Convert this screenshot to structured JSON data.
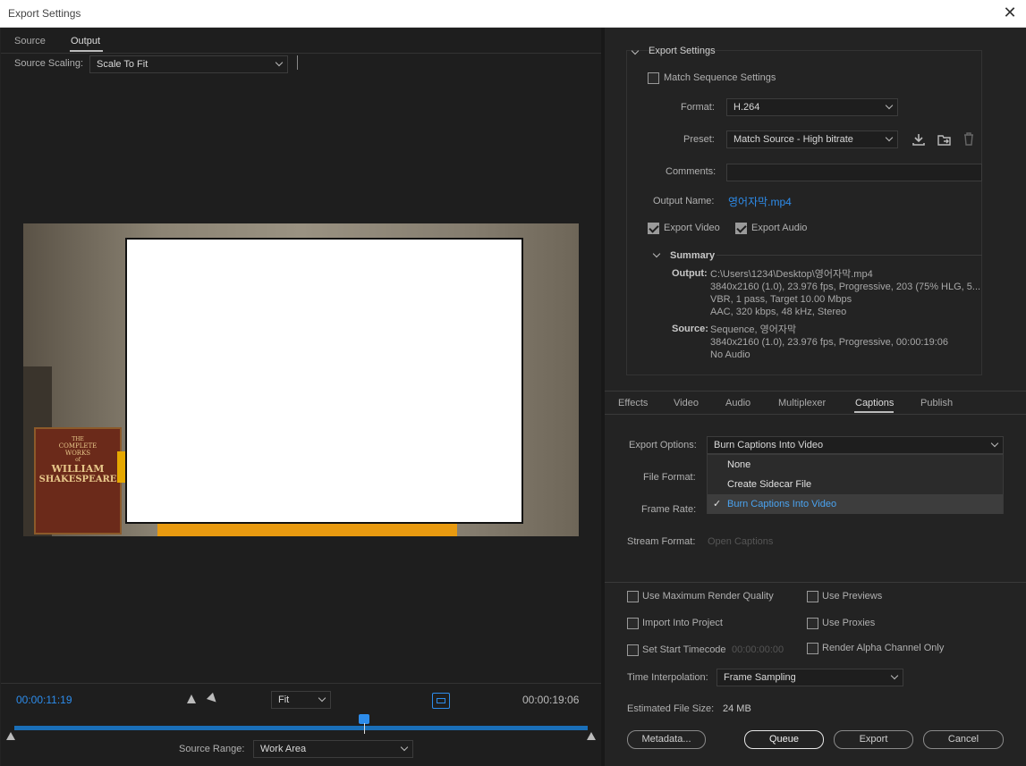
{
  "window": {
    "title": "Export Settings",
    "close_glyph": "✕"
  },
  "left": {
    "tabs": [
      {
        "label": "Source"
      },
      {
        "label": "Output"
      }
    ],
    "source_scaling_label": "Source Scaling:",
    "source_scaling_value": "Scale To Fit",
    "preview_book": {
      "line1": "THE",
      "line2": "COMPLETE",
      "line3": "WORKS",
      "line4": "of",
      "line5": "WILLIAM",
      "line6": "SHAKESPEARE"
    },
    "timecode_current": "00:00:11:19",
    "timecode_total": "00:00:19:06",
    "zoom_value": "Fit",
    "source_range_label": "Source Range:",
    "source_range_value": "Work Area",
    "playhead_fraction": 0.61
  },
  "export_settings": {
    "section_title": "Export Settings",
    "match_sequence_label": "Match Sequence Settings",
    "match_sequence_checked": false,
    "format_label": "Format:",
    "format_value": "H.264",
    "preset_label": "Preset:",
    "preset_value": "Match Source - High bitrate",
    "comments_label": "Comments:",
    "comments_value": "",
    "output_name_label": "Output Name:",
    "output_name_value": "영어자막.mp4",
    "export_video_label": "Export Video",
    "export_audio_label": "Export Audio",
    "summary_title": "Summary",
    "output_key": "Output:",
    "output_lines": [
      "C:\\Users\\1234\\Desktop\\영어자막.mp4",
      "3840x2160 (1.0), 23.976 fps, Progressive, 203 (75% HLG, 5...",
      "VBR, 1 pass, Target 10.00 Mbps",
      "AAC, 320 kbps, 48 kHz, Stereo"
    ],
    "source_key": "Source:",
    "source_lines": [
      "Sequence, 영어자막",
      "3840x2160 (1.0), 23.976 fps, Progressive, 00:00:19:06",
      "No Audio"
    ]
  },
  "settings_tabs": [
    {
      "label": "Effects"
    },
    {
      "label": "Video"
    },
    {
      "label": "Audio"
    },
    {
      "label": "Multiplexer"
    },
    {
      "label": "Captions"
    },
    {
      "label": "Publish"
    }
  ],
  "captions": {
    "export_options_label": "Export Options:",
    "export_options_value": "Burn Captions Into Video",
    "file_format_label": "File Format:",
    "frame_rate_label": "Frame Rate:",
    "stream_format_label": "Stream Format:",
    "stream_format_value": "Open Captions",
    "menu_options": [
      "None",
      "Create Sidecar File",
      "Burn Captions Into Video"
    ],
    "check_glyph": "✓"
  },
  "bottom": {
    "use_max_render_quality": "Use Maximum Render Quality",
    "use_previews": "Use Previews",
    "import_into_project": "Import Into Project",
    "use_proxies": "Use Proxies",
    "set_start_timecode": "Set Start Timecode",
    "start_timecode_value": "00:00:00:00",
    "render_alpha": "Render Alpha Channel Only",
    "time_interpolation_label": "Time Interpolation:",
    "time_interpolation_value": "Frame Sampling",
    "estimated_size_label": "Estimated File Size:",
    "estimated_size_value": "24 MB",
    "metadata_button": "Metadata...",
    "queue_button": "Queue",
    "export_button": "Export",
    "cancel_button": "Cancel"
  },
  "colors": {
    "accent_blue": "#2d8ceb",
    "panel_bg": "#232323",
    "preview_bg": "#1e1e1e"
  }
}
